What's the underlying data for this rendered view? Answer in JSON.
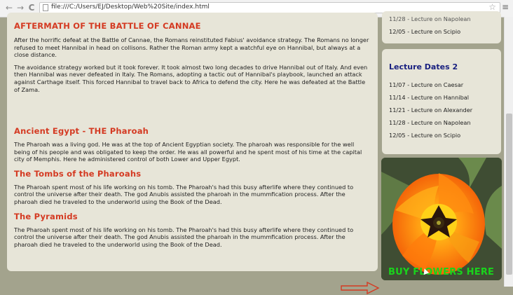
{
  "browser": {
    "url": "file:///C:/Users/EJ/Desktop/Web%20Site/index.html",
    "back_icon": "←",
    "forward_icon": "→",
    "reload_icon": "C",
    "star_icon": "☆",
    "menu_icon": "≡"
  },
  "main": {
    "aftermath": {
      "title": "AFTERMATH OF THE BATTLE OF CANNAE",
      "p1": "After the horrific defeat at the Battle of Cannae, the Romans reinstituted Fabius' avoidance strategy. The Romans no longer refused to meet Hannibal in head on collisons. Rather the Roman army kept a watchful eye on Hannibal, but always at a close distance.",
      "p2": "The avoidance strategy worked but it took forever. It took almost two long decades to drive Hannibal out of Italy. And even then Hannibal was never defeated in Italy. The Romans, adopting a tactic out of Hannibal's playbook, launched an attack against Carthage itself. This forced Hannibal to travel back to Africa to defend the city. Here he was defeated at the Battle of Zama."
    },
    "egypt": {
      "title": "Ancient Egypt - THE Pharoah",
      "text": "The Pharoah was a living god. He was at the top of Ancient Egyptian society. The pharoah was responsible for the well being of his people and was obligated to keep the order. He was all powerful and he spent most of his time at the capital city of Memphis. Here he administered control of both Lower and Upper Egypt."
    },
    "tombs": {
      "title": "The Tombs of the Pharoahs",
      "text": "The Pharoah spent most of his life working on his tomb. The Pharoah's had this busy afterlife where they continued to control the universe after their death. The god Anubis assisted the pharoah in the mummfication process. After the pharoah died he traveled to the underworld using the Book of the Dead."
    },
    "pyramids": {
      "title": "The Pyramids",
      "text": "The Pharoah spent most of his life working on his tomb. The Pharoah's had this busy afterlife where they continued to control the universe after their death. The god Anubis assisted the pharoah in the mummfication process. After the pharoah died he traveled to the underworld using the Book of the Dead."
    }
  },
  "sidebar": {
    "box1": {
      "partial_item": "11/28 - Lecture on Napolean",
      "last_item": "12/05 - Lecture on Scipio"
    },
    "box2": {
      "title": "Lecture Dates 2",
      "items": [
        "11/07 - Lecture on Caesar",
        "11/14 - Lecture on Hannibal",
        "11/21 - Lecture on Alexander",
        "11/28 - Lecture on Napolean",
        "12/05 - Lecture on Scipio"
      ]
    },
    "promo": {
      "link_text": "BUY FLOWERS HERE",
      "colors": {
        "link": "#19d41c",
        "arrow": "#d43a22"
      }
    }
  },
  "colors": {
    "page_bg": "#a3a38d",
    "box_bg": "#e7e5d8",
    "heading_red": "#d43a22",
    "heading_navy": "#1a2180"
  }
}
